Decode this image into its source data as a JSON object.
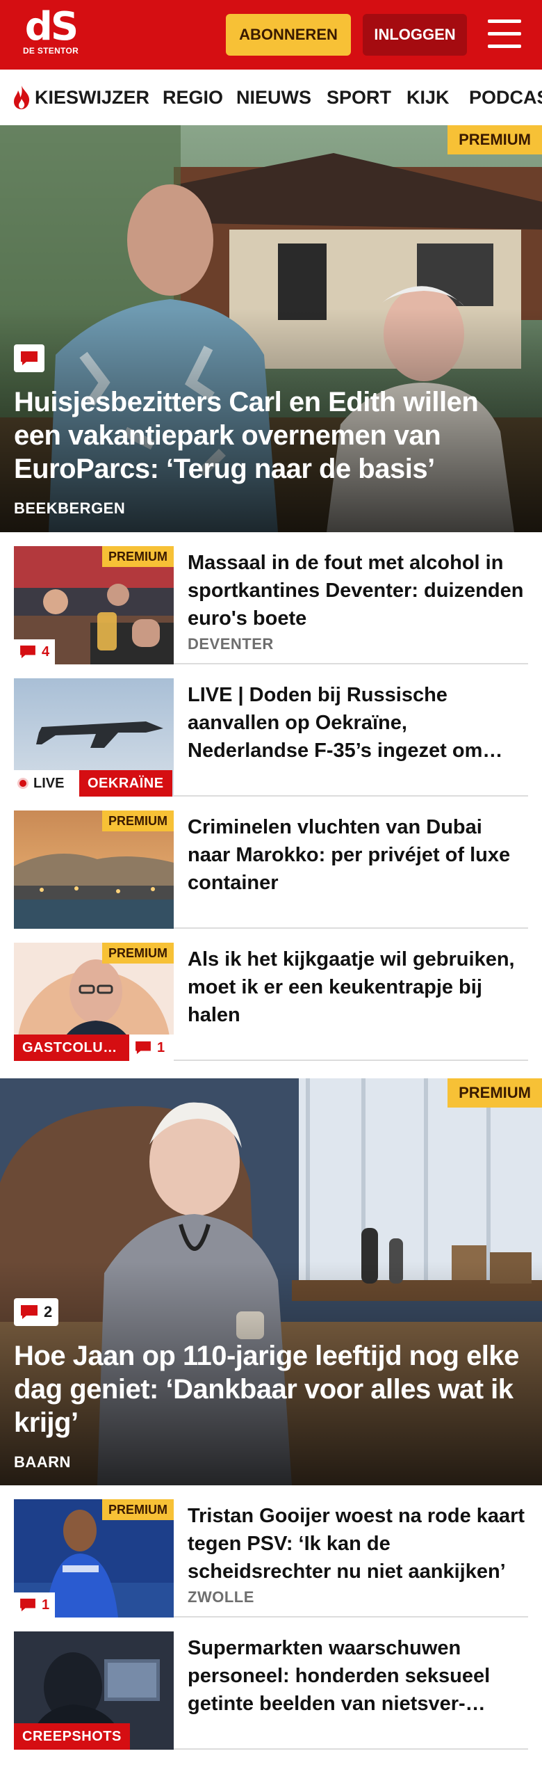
{
  "header": {
    "logo_main": "dS",
    "logo_sub": "DE STENTOR",
    "subscribe_label": "ABONNEREN",
    "login_label": "INLOGGEN"
  },
  "nav": {
    "items": [
      "KIESWIJZER",
      "REGIO",
      "NIEUWS",
      "SPORT",
      "KIJK",
      "PODCAS"
    ]
  },
  "colors": {
    "brand": "#d50e12",
    "premium": "#f7c136"
  },
  "premium_label": "PREMIUM",
  "hero1": {
    "title": "Huisjesbezitters Carl en Edith willen een vakantiepark overnemen van EuroParcs: ‘Terug naar de basis’",
    "location": "BEEKBERGEN",
    "comment_icon": "comment-icon"
  },
  "articles": [
    {
      "title": "Massaal in de fout met alcohol in sportkantines Deventer: duizenden euro's boete",
      "location": "DEVENTER",
      "premium": "PREMIUM",
      "comments": "4"
    },
    {
      "title": "LIVE | Doden bij Russische aanvallen op Oekraïne, Nederlandse F-35’s ingezet om…",
      "live_label": "LIVE",
      "tag": "OEKRAÏNE"
    },
    {
      "title": "Criminelen vluchten van Dubai naar Marokko: per privéjet of luxe container",
      "premium": "PREMIUM"
    },
    {
      "title": "Als ik het kijkgaatje wil gebruiken, moet ik er een keukentrapje bij halen",
      "premium": "PREMIUM",
      "tag": "GASTCOLU…",
      "comments": "1"
    }
  ],
  "hero2": {
    "title": "Hoe Jaan op 110-jarige leeftijd nog elke dag geniet: ‘Dankbaar voor alles wat ik krijg’",
    "location": "BAARN",
    "comments": "2"
  },
  "articles2": [
    {
      "title": "Tristan Gooijer woest na rode kaart tegen PSV: ‘Ik kan de scheidsrechter nu niet aankijken’",
      "location": "ZWOLLE",
      "premium": "PREMIUM",
      "comments": "1"
    },
    {
      "title": "Supermarkten waarschuwen personeel: honderden seksueel getinte beelden van nietsver-…",
      "tag": "CREEPSHOTS"
    }
  ]
}
